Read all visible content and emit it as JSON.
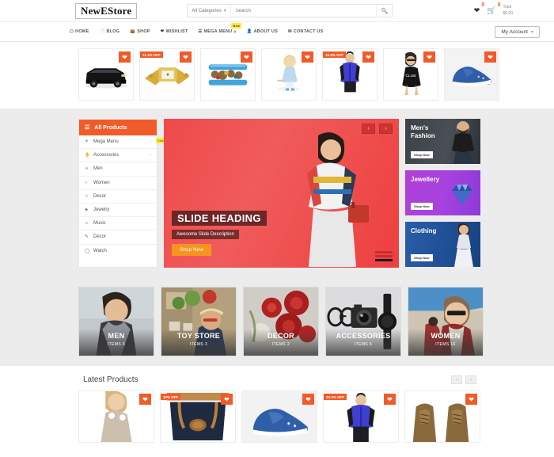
{
  "header": {
    "logo": "NewEStore",
    "search": {
      "category_label": "All Categories",
      "placeholder": "Search",
      "value": "",
      "button_icon": "search-icon"
    },
    "wishlist_count": "0",
    "cart_count": "0",
    "cart_total_label": "Total",
    "cart_total_value": "$0.00"
  },
  "nav": {
    "items": [
      {
        "label": "HOME",
        "icon": "home-icon"
      },
      {
        "label": "BLOG",
        "icon": "file-icon"
      },
      {
        "label": "SHOP",
        "icon": "bag-icon"
      },
      {
        "label": "WISHLIST",
        "icon": "heart-icon"
      },
      {
        "label": "MEGA MENU",
        "icon": "list-icon",
        "badge": "New",
        "caret": true
      },
      {
        "label": "ABOUT US",
        "icon": "user-icon"
      },
      {
        "label": "CONTACT US",
        "icon": "mail-icon"
      }
    ],
    "account_label": "My Account"
  },
  "top_strip": {
    "items": [
      {
        "name": "black-suv-car",
        "discount": "",
        "wishlist_icon": "heart-icon"
      },
      {
        "name": "gold-watch",
        "discount": "11.1% OFF",
        "wishlist_icon": "heart-icon"
      },
      {
        "name": "blue-bracelet",
        "discount": "",
        "wishlist_icon": "heart-icon"
      },
      {
        "name": "doll-figure",
        "discount": "",
        "wishlist_icon": "heart-icon"
      },
      {
        "name": "blue-puffer-vest",
        "discount": "33.3% OFF",
        "wishlist_icon": "heart-icon"
      },
      {
        "name": "black-dress-model",
        "discount": "",
        "wishlist_icon": "heart-icon"
      },
      {
        "name": "blue-sneaker",
        "discount": "",
        "wishlist_icon": "heart-icon"
      }
    ]
  },
  "sidebar": {
    "title": "All Products",
    "menu_icon": "hamburger-icon",
    "items": [
      {
        "label": "Mega Menu",
        "icon": "tree-icon",
        "arrow": true,
        "badge": "Sale"
      },
      {
        "label": "Accessories",
        "icon": "hand-icon",
        "arrow": true
      },
      {
        "label": "Men",
        "icon": "tie-icon"
      },
      {
        "label": "Women",
        "icon": "chat-icon"
      },
      {
        "label": "Decor",
        "icon": "star-icon"
      },
      {
        "label": "Jewelry",
        "icon": "gem-icon"
      },
      {
        "label": "Music",
        "icon": "music-icon"
      },
      {
        "label": "Decor",
        "icon": "pen-icon"
      },
      {
        "label": "Watch",
        "icon": "clock-icon"
      }
    ]
  },
  "slider": {
    "heading": "SLIDE HEADING",
    "description": "Awesome Slide Description",
    "button_label": "Shop Now",
    "prev_icon": "chevron-left-icon",
    "next_icon": "chevron-right-icon"
  },
  "banners": [
    {
      "title": "Men's Fashion",
      "button_label": "Shop Now"
    },
    {
      "title": "Jewellery",
      "button_label": "Shop Now"
    },
    {
      "title": "Clothing",
      "button_label": "Shop Now"
    }
  ],
  "category_tiles": [
    {
      "name": "MEN",
      "items": "ITEMS 6"
    },
    {
      "name": "TOY STORE",
      "items": "ITEMS 3"
    },
    {
      "name": "DECOR",
      "items": "ITEMS 2"
    },
    {
      "name": "ACCESSORIES",
      "items": "ITEMS 6"
    },
    {
      "name": "WOMEN",
      "items": "ITEMS 16"
    }
  ],
  "latest_products": {
    "title": "Latest Products",
    "prev_icon": "chevron-left-icon",
    "next_icon": "chevron-right-icon",
    "items": [
      {
        "name": "beige-top-model",
        "discount": "",
        "wishlist_icon": "heart-icon"
      },
      {
        "name": "navy-leather-bag",
        "discount": "10% OFF",
        "wishlist_icon": "heart-icon"
      },
      {
        "name": "blue-sneaker",
        "discount": "",
        "wishlist_icon": "heart-icon"
      },
      {
        "name": "blue-puffer-vest",
        "discount": "33.3% OFF",
        "wishlist_icon": "heart-icon"
      },
      {
        "name": "brown-leather-shoes",
        "discount": "",
        "wishlist_icon": "heart-icon"
      }
    ]
  },
  "colors": {
    "accent": "#f15b2a",
    "slider_bg": "#ee4444",
    "badge_yellow": "#ffeb3b",
    "shop_now_orange": "#f7941e"
  }
}
